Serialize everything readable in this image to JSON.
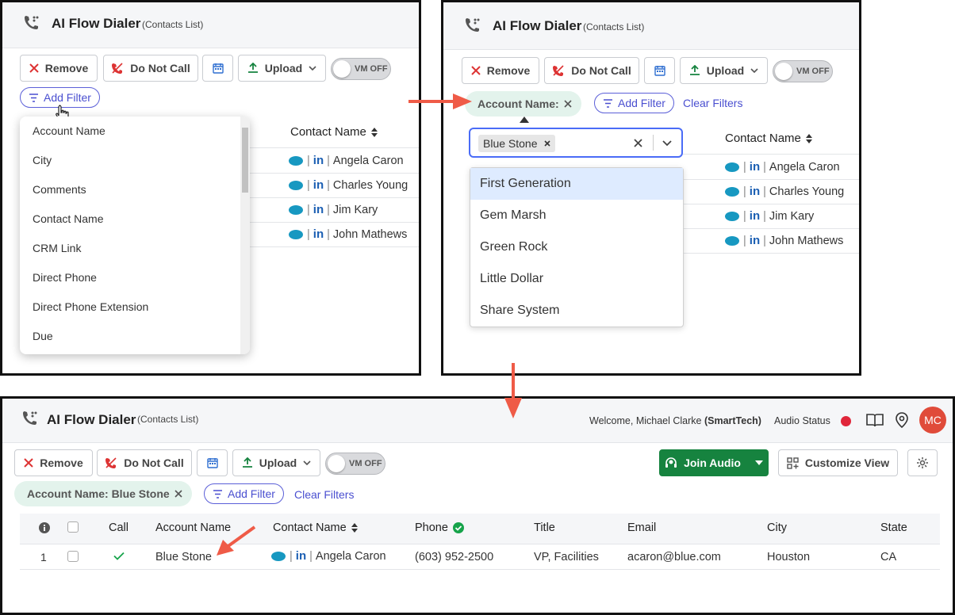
{
  "app": {
    "title": "AI Flow Dialer",
    "subtitle": "(Contacts List)"
  },
  "toolbar": {
    "remove": "Remove",
    "do_not_call": "Do Not Call",
    "upload": "Upload",
    "vm_toggle": "VM OFF"
  },
  "filters": {
    "add_filter": "Add Filter",
    "clear_filters": "Clear Filters",
    "account_name_label": "Account Name:",
    "account_name_applied": "Account Name: Blue Stone",
    "field_options": [
      "Account Name",
      "City",
      "Comments",
      "Contact Name",
      "CRM Link",
      "Direct Phone",
      "Direct Phone Extension",
      "Due"
    ],
    "selected_value": "Blue Stone",
    "value_options": [
      "First Generation",
      "Gem Marsh",
      "Green Rock",
      "Little Dollar",
      "Share System"
    ]
  },
  "contacts_preview": {
    "column": "Contact Name",
    "names": [
      "Angela Caron",
      "Charles Young",
      "Jim Kary",
      "John Mathews"
    ]
  },
  "header_right": {
    "welcome": "Welcome, Michael Clarke",
    "company": "(SmartTech)",
    "audio_status": "Audio Status",
    "avatar_initials": "MC"
  },
  "actions": {
    "join_audio": "Join Audio",
    "customize_view": "Customize View"
  },
  "table": {
    "columns": [
      "Call",
      "Account Name",
      "Contact Name",
      "Phone",
      "Title",
      "Email",
      "City",
      "State"
    ],
    "rows": [
      {
        "index": "1",
        "account": "Blue Stone",
        "contact": "Angela Caron",
        "phone": "(603) 952-2500",
        "title": "VP, Facilities",
        "email": "acaron@blue.com",
        "city": "Houston",
        "state": "CA"
      }
    ]
  },
  "colors": {
    "accent": "#4a4fd0",
    "join_audio": "#16833f",
    "annotation_arrow": "#ef5b47",
    "avatar": "#e04b3a",
    "salesforce": "#1798c1",
    "linkedin": "#1b5fb3"
  }
}
